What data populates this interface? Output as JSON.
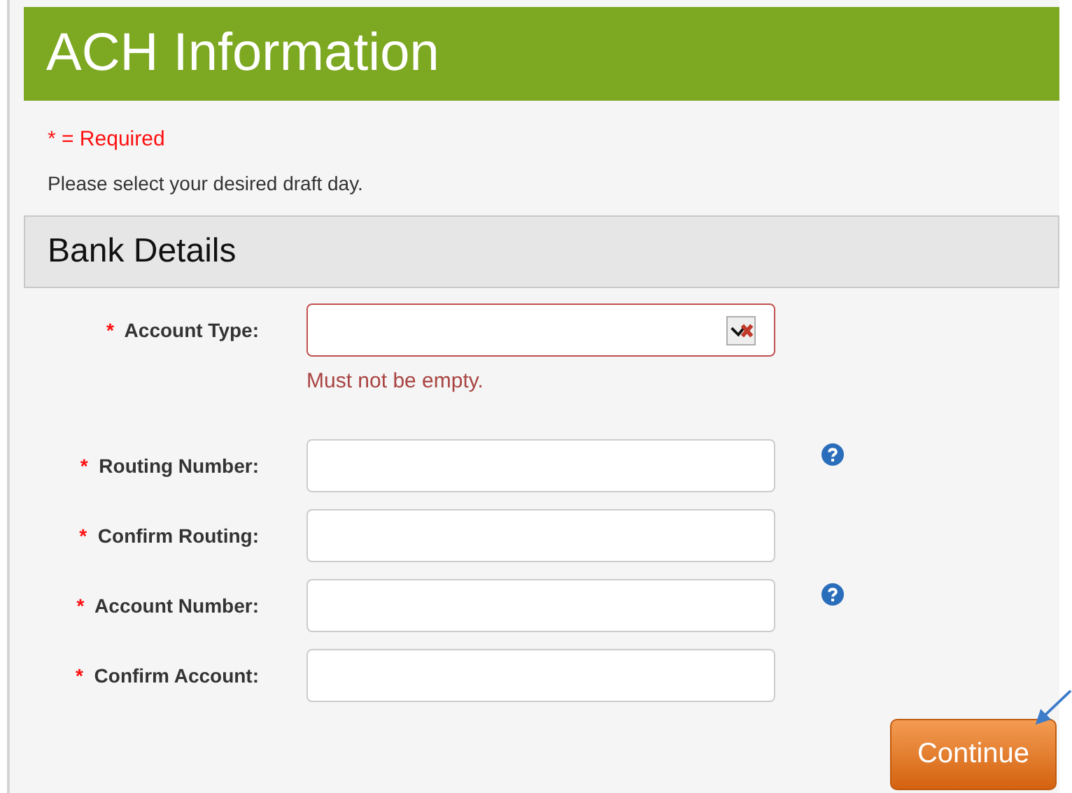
{
  "header": {
    "title": "ACH Information"
  },
  "required_note": "* = Required",
  "instructions": "Please select your desired draft day.",
  "section": {
    "title": "Bank Details"
  },
  "fields": [
    {
      "kind": "select",
      "label": "Account Type:",
      "required_mark": "*",
      "invalid": true,
      "error": "Must not be empty.",
      "help": false
    },
    {
      "kind": "text",
      "label": "Routing Number:",
      "required_mark": "*",
      "invalid": false,
      "help": true
    },
    {
      "kind": "text",
      "label": "Confirm Routing:",
      "required_mark": "*",
      "invalid": false,
      "help": false
    },
    {
      "kind": "text",
      "label": "Account Number:",
      "required_mark": "*",
      "invalid": false,
      "help": true
    },
    {
      "kind": "text",
      "label": "Confirm Account:",
      "required_mark": "*",
      "invalid": false,
      "help": false
    }
  ],
  "continue_button": "Continue"
}
